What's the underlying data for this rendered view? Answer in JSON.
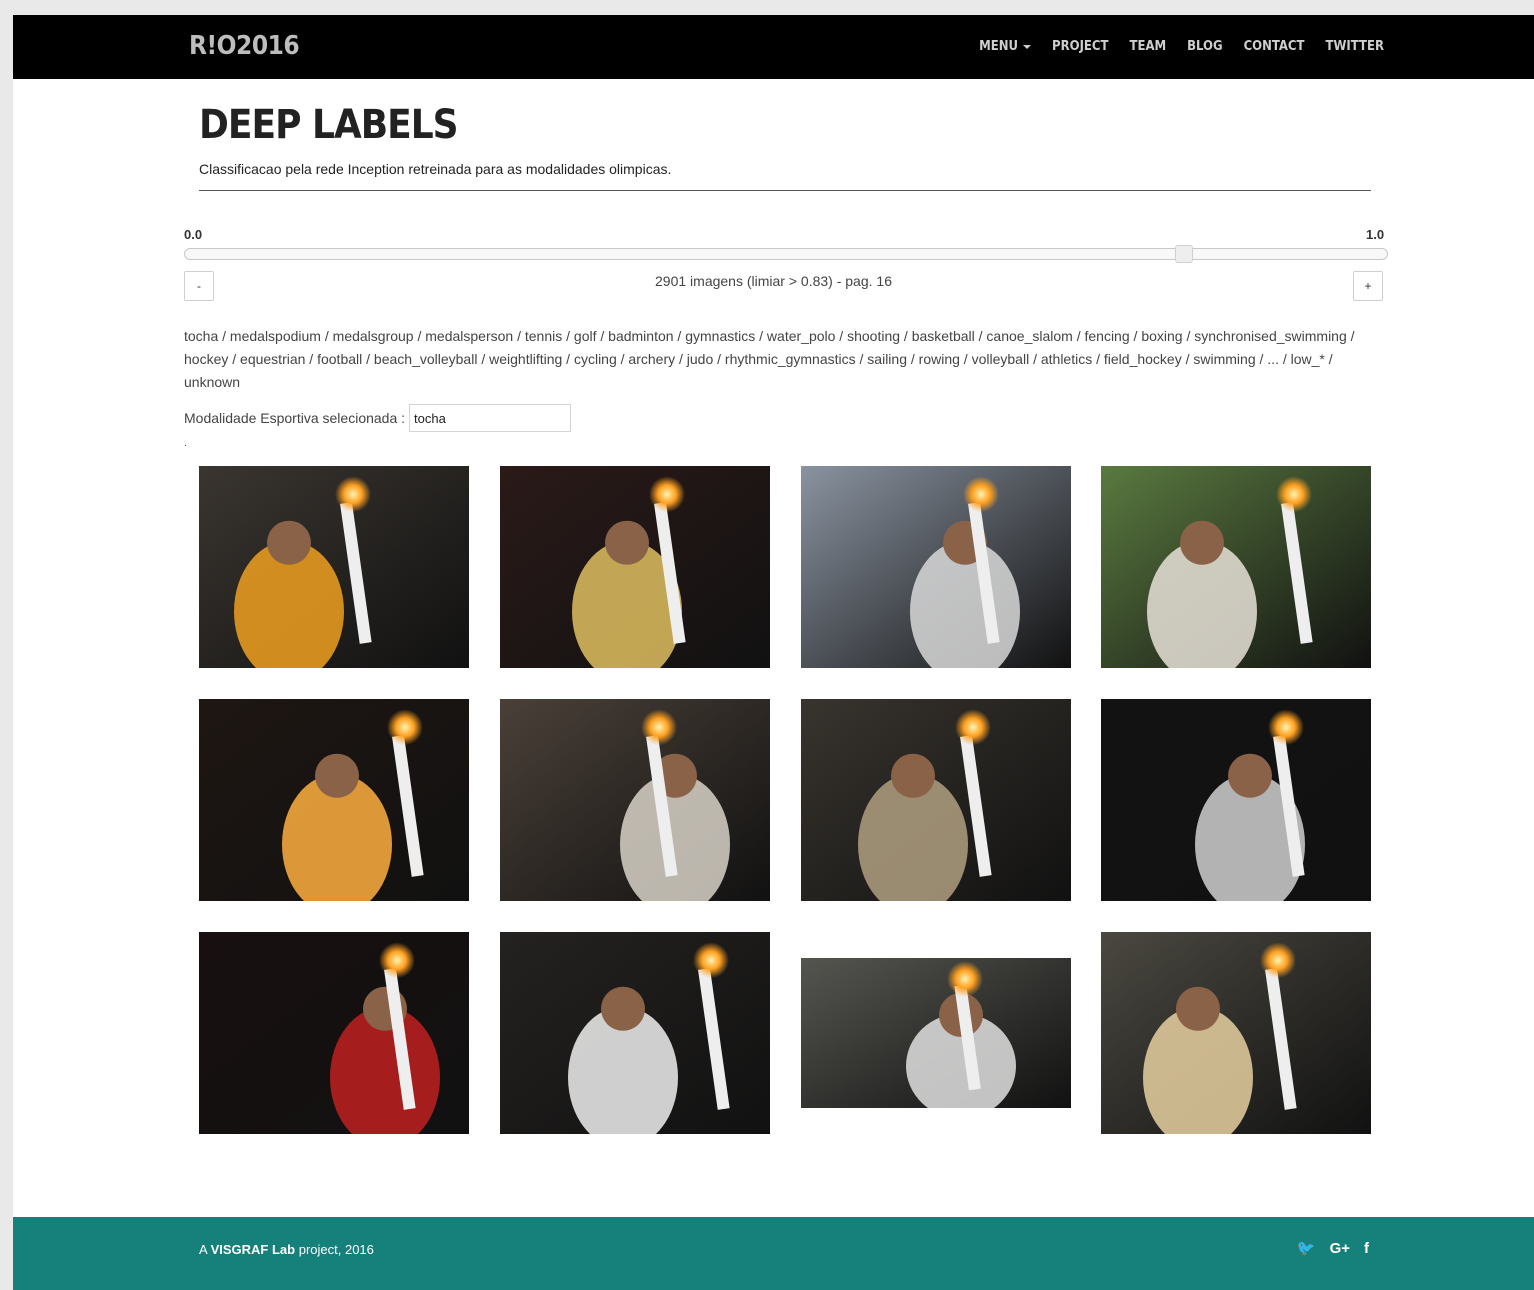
{
  "navbar": {
    "brand": "R!O2016",
    "links": [
      {
        "label": "MENU",
        "name": "nav-menu"
      },
      {
        "label": "PROJECT",
        "name": "nav-project"
      },
      {
        "label": "TEAM",
        "name": "nav-team"
      },
      {
        "label": "BLOG",
        "name": "nav-blog"
      },
      {
        "label": "CONTACT",
        "name": "nav-contact"
      },
      {
        "label": "TWITTER",
        "name": "nav-twitter"
      }
    ]
  },
  "header": {
    "title": "DEEP LABELS",
    "subtitle": "Classificacao pela rede Inception retreinada para as modalidades olimpicas."
  },
  "slider": {
    "min_label": "0.0",
    "max_label": "1.0",
    "value": 0.83
  },
  "pagination": {
    "prev_label": "-",
    "next_label": "+",
    "status": "2901 imagens (limiar > 0.83) - pag. 16"
  },
  "labels": [
    "tocha",
    "medalspodium",
    "medalsgroup",
    "medalsperson",
    "tennis",
    "golf",
    "badminton",
    "gymnastics",
    "water_polo",
    "shooting",
    "basketball",
    "canoe_slalom",
    "fencing",
    "boxing",
    "synchronised_swimming",
    "hockey",
    "equestrian",
    "football",
    "beach_volleyball",
    "weightlifting",
    "cycling",
    "archery",
    "judo",
    "rhythmic_gymnastics",
    "sailing",
    "rowing",
    "volleyball",
    "athletics",
    "field_hockey",
    "swimming",
    "...",
    "low_*",
    "unknown"
  ],
  "selector": {
    "label": "Modalidade Esportiva selecionada :",
    "value": "tocha",
    "dot": "."
  },
  "images": [
    {
      "name": "torch-photo-1",
      "bg": "#3a3530",
      "accent": "#f0a020"
    },
    {
      "name": "torch-photo-2",
      "bg": "#2a1a18",
      "accent": "#e0c060"
    },
    {
      "name": "torch-photo-3",
      "bg": "#8a93a0",
      "accent": "#d8d8d8"
    },
    {
      "name": "torch-photo-4",
      "bg": "#5a7a40",
      "accent": "#e8e2d8"
    },
    {
      "name": "torch-photo-5",
      "bg": "#1e1612",
      "accent": "#ffb040"
    },
    {
      "name": "torch-photo-6",
      "bg": "#4a4038",
      "accent": "#d8d2c8"
    },
    {
      "name": "torch-photo-7",
      "bg": "#38342e",
      "accent": "#b0a080"
    },
    {
      "name": "torch-photo-8",
      "bg": "#121212",
      "accent": "#d0d0d0"
    },
    {
      "name": "torch-photo-9",
      "bg": "#181010",
      "accent": "#c02020"
    },
    {
      "name": "torch-photo-10",
      "bg": "#242220",
      "accent": "#f0f0f0"
    },
    {
      "name": "torch-photo-11",
      "bg": "#555550",
      "accent": "#e0e0e0"
    },
    {
      "name": "torch-photo-12",
      "bg": "#4a4840",
      "accent": "#e8d0a0"
    }
  ],
  "footer": {
    "prefix": "A",
    "lab": "VISGRAF Lab",
    "suffix": "project, 2016",
    "social": [
      {
        "glyph": "🐦",
        "name": "twitter-icon"
      },
      {
        "glyph": "G+",
        "name": "google-plus-icon"
      },
      {
        "glyph": "f",
        "name": "facebook-icon"
      }
    ]
  }
}
